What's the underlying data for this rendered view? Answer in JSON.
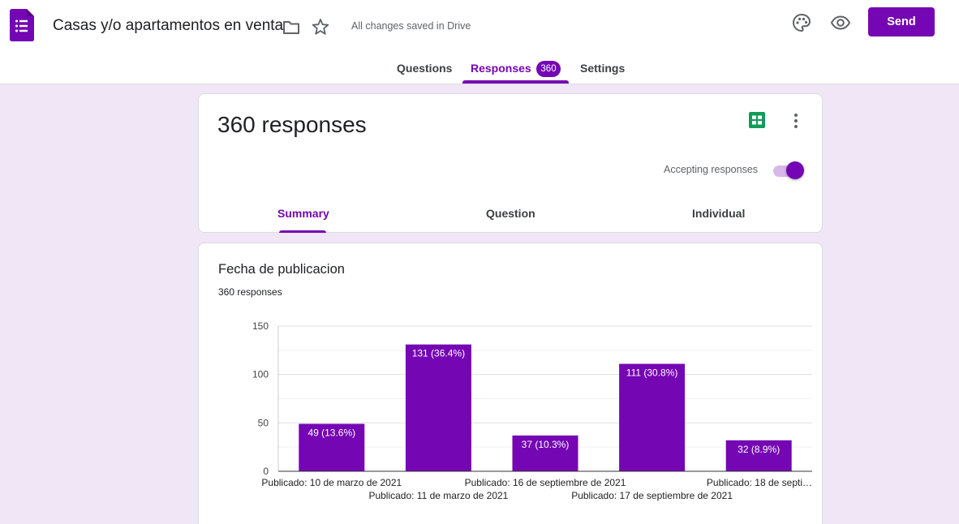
{
  "app": {
    "title": "Casas y/o apartamentos en venta",
    "save_status": "All changes saved in Drive",
    "send_label": "Send",
    "icons": [
      "forms-logo-icon",
      "folder-icon",
      "star-icon",
      "palette-icon",
      "eye-icon"
    ],
    "accent_color": "#7506b3"
  },
  "tabs": {
    "questions": "Questions",
    "responses": "Responses",
    "responses_badge": "360",
    "settings": "Settings",
    "active": "responses"
  },
  "responses_card": {
    "title": "360 responses",
    "accepting_label": "Accepting responses",
    "accepting": true,
    "subtabs": {
      "summary": "Summary",
      "question": "Question",
      "individual": "Individual",
      "active": "summary"
    }
  },
  "question": {
    "title": "Fecha de publicacion",
    "count": "360 responses"
  },
  "chart_data": {
    "type": "bar",
    "categories": [
      "Publicado: 10 de marzo de 2021",
      "Publicado: 11 de marzo de 2021",
      "Publicado: 16 de septiembre de 2021",
      "Publicado: 17 de septiembre de 2021",
      "Publicado: 18 de septi…"
    ],
    "values": [
      49,
      131,
      37,
      111,
      32
    ],
    "data_labels": [
      "49 (13.6%)",
      "131 (36.4%)",
      "37 (10.3%)",
      "111 (30.8%)",
      "32 (8.9%)"
    ],
    "yticks": [
      0,
      50,
      100,
      150
    ],
    "ylim": [
      0,
      150
    ],
    "grid": true,
    "bar_color": "#7506b3"
  }
}
